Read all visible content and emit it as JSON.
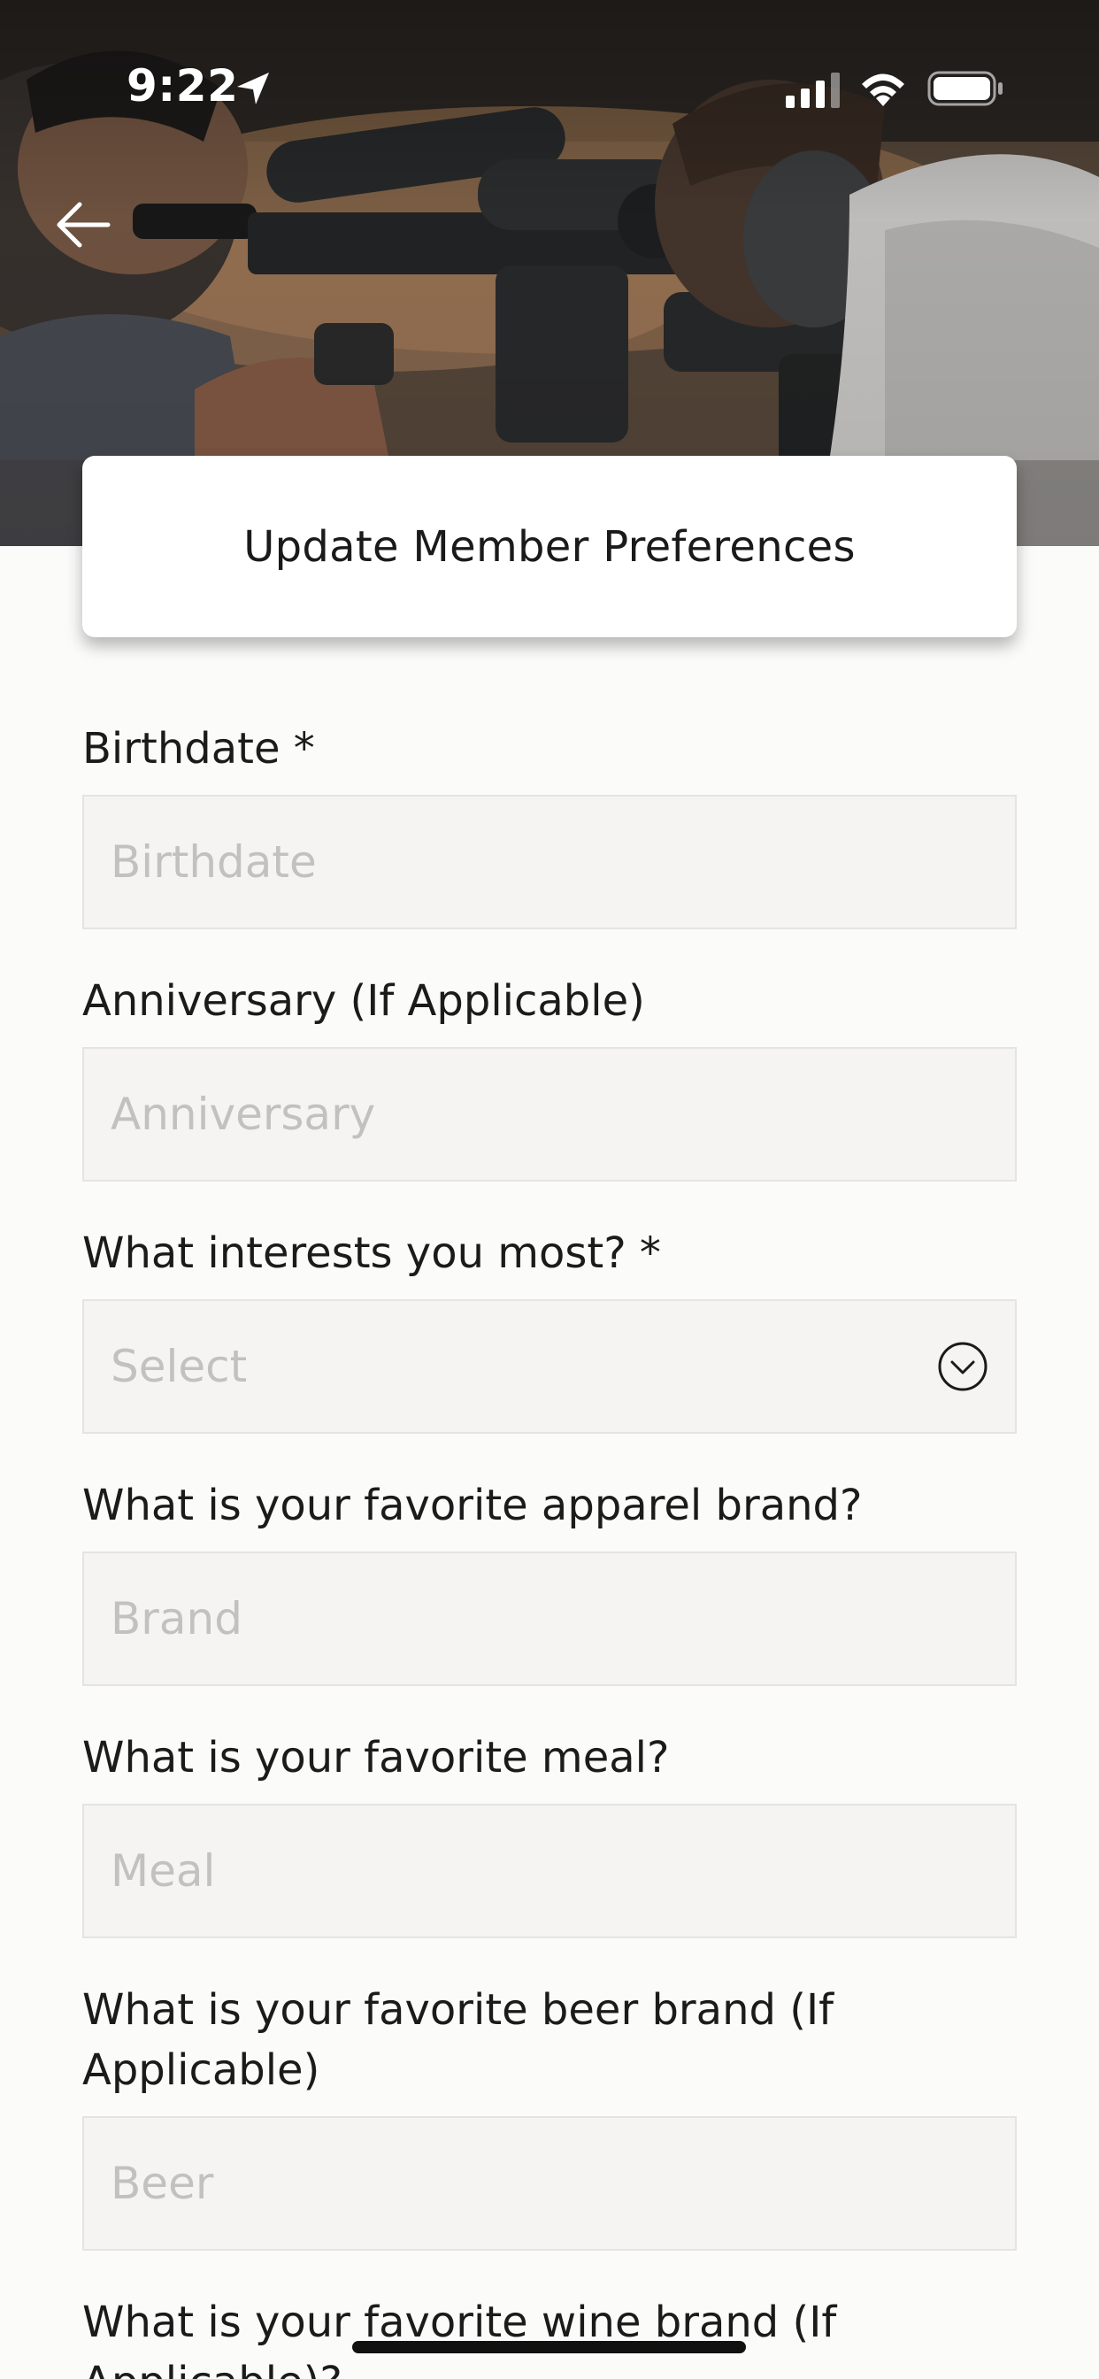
{
  "status_bar": {
    "time": "9:22"
  },
  "header": {
    "title": "Update Member Preferences",
    "back_icon": "arrow-left-icon"
  },
  "form": {
    "fields": [
      {
        "label": "Birthdate *",
        "placeholder": "Birthdate",
        "type": "text"
      },
      {
        "label": "Anniversary (If Applicable)",
        "placeholder": "Anniversary",
        "type": "text"
      },
      {
        "label": "What interests you most?  *",
        "placeholder": "Select",
        "type": "select"
      },
      {
        "label": "What is your favorite apparel brand?",
        "placeholder": "Brand",
        "type": "text"
      },
      {
        "label": "What is your favorite meal?",
        "placeholder": "Meal",
        "type": "text"
      },
      {
        "label": "What is your favorite beer brand (If Applicable)",
        "placeholder": "Beer",
        "type": "text"
      },
      {
        "label": "What is your favorite wine brand (If Applicable)?",
        "placeholder": "",
        "type": "text"
      }
    ]
  },
  "colors": {
    "background": "#fbfbfa",
    "field_fill": "#f5f4f2",
    "placeholder": "#c3c1bd",
    "text": "#1b1b1b"
  }
}
